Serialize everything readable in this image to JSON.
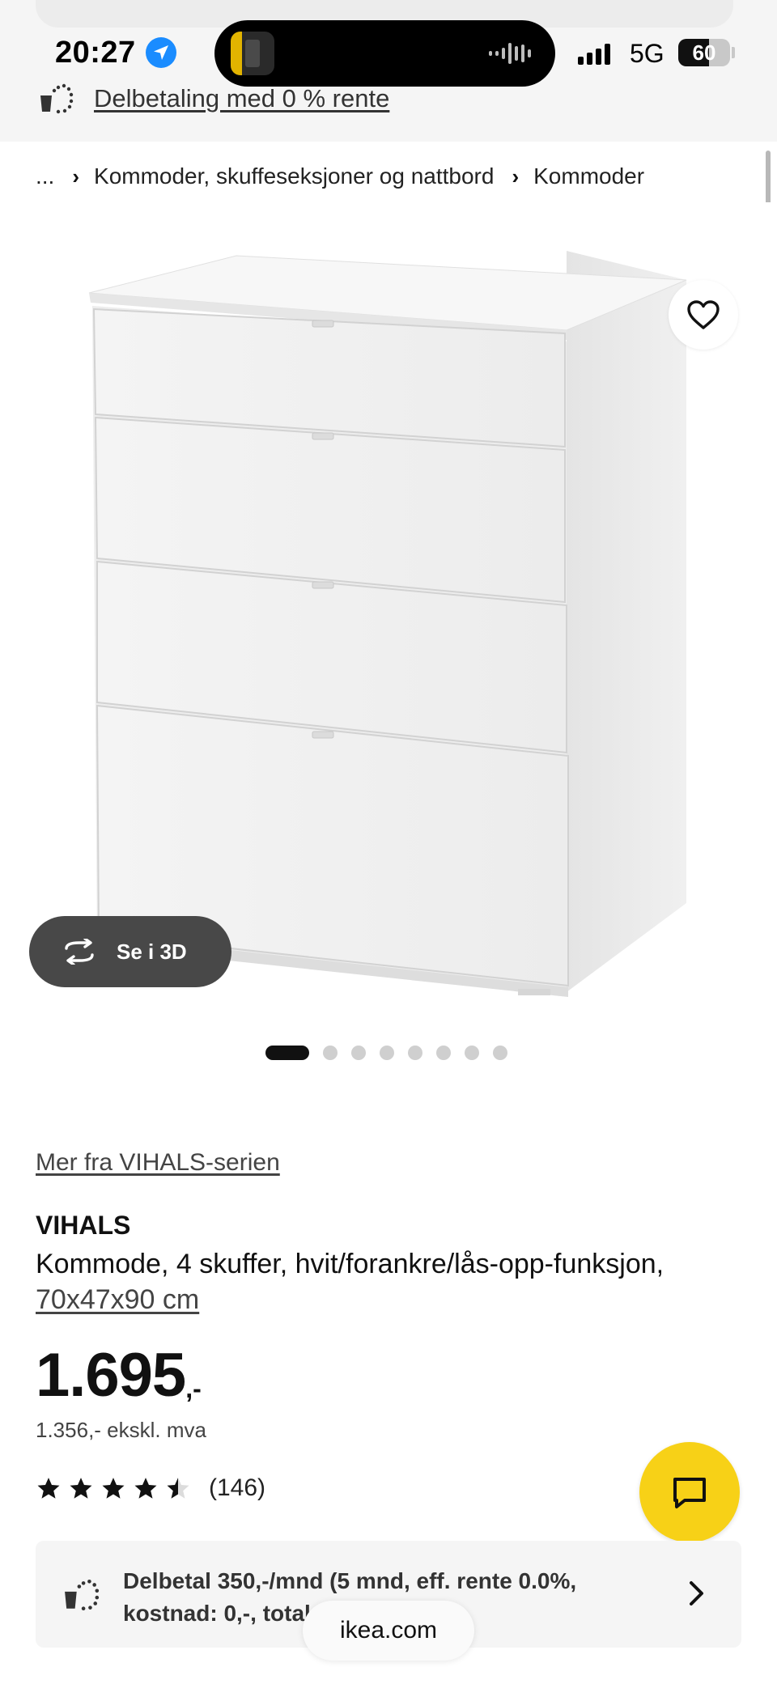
{
  "status_bar": {
    "time": "20:27",
    "network": "5G",
    "battery": "60",
    "battery_level": 0.6
  },
  "promo": {
    "label": "Delbetaling med 0 % rente",
    "icon": "installment-icon"
  },
  "breadcrumb": {
    "items": [
      "...",
      "Kommoder, skuffeseksjoner og nattbord",
      "Kommoder"
    ]
  },
  "gallery": {
    "see_3d_label": "Se i 3D",
    "image_count": 8,
    "active_index": 0
  },
  "product": {
    "series_link": "Mer fra VIHALS-serien",
    "name": "VIHALS",
    "description": "Kommode, 4 skuffer, hvit/forankre/lås-opp-funksjon,",
    "measure": "70x47x90 cm",
    "price": "1.695",
    "price_suffix": ",-",
    "price_ex_vat": "1.356,- ekskl. mva",
    "rating_value": 4.5,
    "rating_max": 5,
    "rating_count": "(146)"
  },
  "finance": {
    "line1": "Delbetal 350,-/mnd (5 mnd, eff. rente 0.0%,",
    "line2": "kostnad: 0,-, total: 1695,-)"
  },
  "browser": {
    "url": "ikea.com"
  },
  "colors": {
    "chat_button": "#f7d117",
    "see3d_button": "#484848",
    "top_area": "#f5f5f5"
  }
}
